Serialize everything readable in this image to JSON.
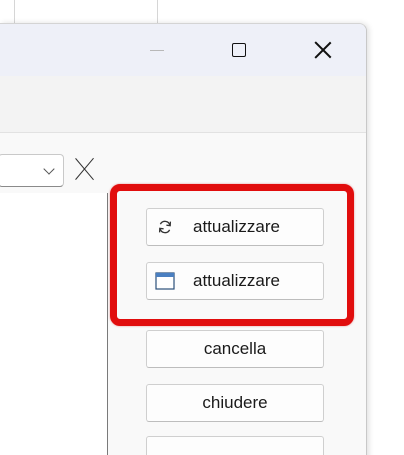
{
  "window": {
    "caption_buttons": [
      "minimize",
      "maximize",
      "close"
    ]
  },
  "search": {
    "combo_value": "",
    "clear_icon": "close-icon"
  },
  "buttons": {
    "refresh_label": "attualizzare",
    "refresh_icon": "refresh-icon",
    "refresh2_label": "attualizzare",
    "refresh2_icon": "window-icon",
    "cancel_label": "cancella",
    "close_label": "chiudere"
  },
  "highlight": {
    "color": "#e10d0d"
  }
}
